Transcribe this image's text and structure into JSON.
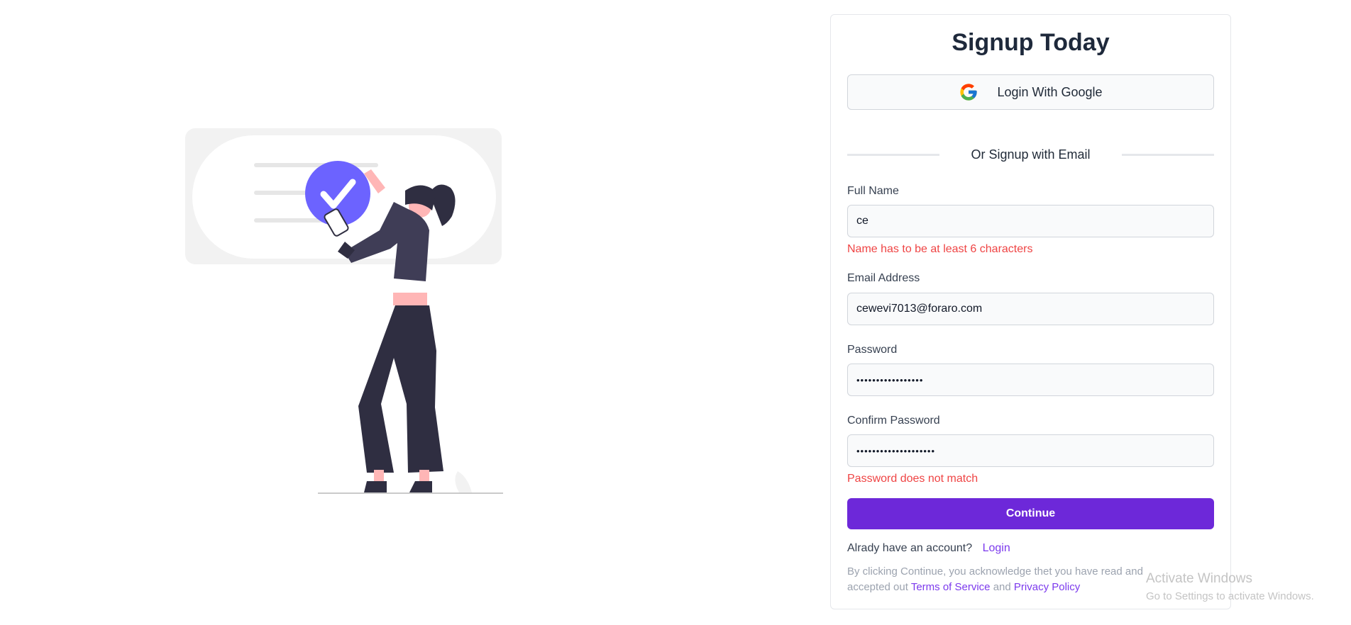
{
  "form": {
    "title": "Signup Today",
    "google_button": "Login With Google",
    "divider_text": "Or Signup with Email",
    "full_name": {
      "label": "Full Name",
      "value": "ce",
      "error": "Name has to be at least 6 characters"
    },
    "email": {
      "label": "Email Address",
      "value": "cewevi7013@foraro.com"
    },
    "password": {
      "label": "Password",
      "value": "•••••••••••••••••"
    },
    "confirm_password": {
      "label": "Confirm Password",
      "value": "••••••••••••••••••••",
      "error": "Password does not match"
    },
    "continue_button": "Continue",
    "account_prompt": "Alrady have an account?",
    "login_link": "Login",
    "legal_prefix": "By clicking Continue, you acknowledge thet you have read and accepted out",
    "terms_link": "Terms of Service",
    "legal_and": "and",
    "privacy_link": "Privacy Policy"
  },
  "watermark": {
    "title": "Activate Windows",
    "subtitle": "Go to Settings to activate Windows."
  },
  "colors": {
    "primary": "#6d28d9",
    "error": "#ef4444",
    "illustration_accent": "#6c63ff"
  },
  "icons": [
    "google-icon",
    "checkmark-icon"
  ]
}
